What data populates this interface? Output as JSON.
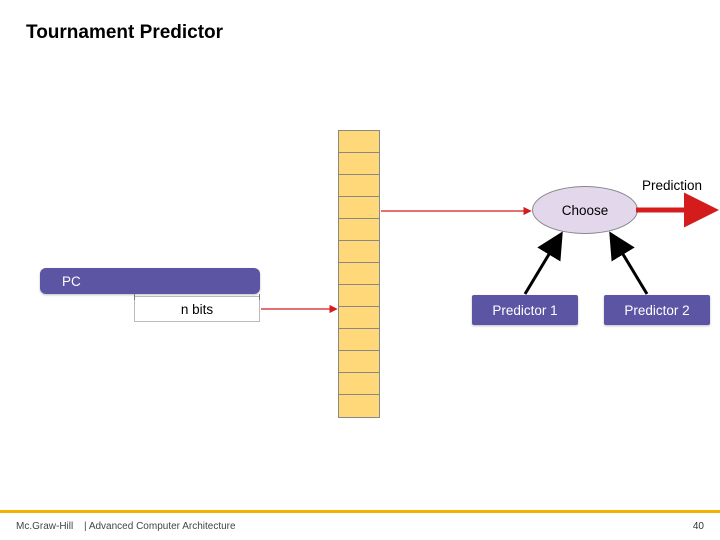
{
  "title": "Tournament Predictor",
  "pc": {
    "label": "PC",
    "nbits_label": "n bits"
  },
  "choose_label": "Choose",
  "predictor1_label": "Predictor 1",
  "predictor2_label": "Predictor 2",
  "prediction_label": "Prediction",
  "footer": {
    "brand": "Mc.Graw-Hill",
    "course": "| Advanced Computer Architecture",
    "page": "40"
  },
  "colors": {
    "accent_yellow": "#f4b200",
    "table_fill": "#ffd879",
    "purple": "#5b55a3",
    "choose_fill": "#e3d7ec",
    "red": "#d41c1c"
  },
  "table_cells": 13
}
